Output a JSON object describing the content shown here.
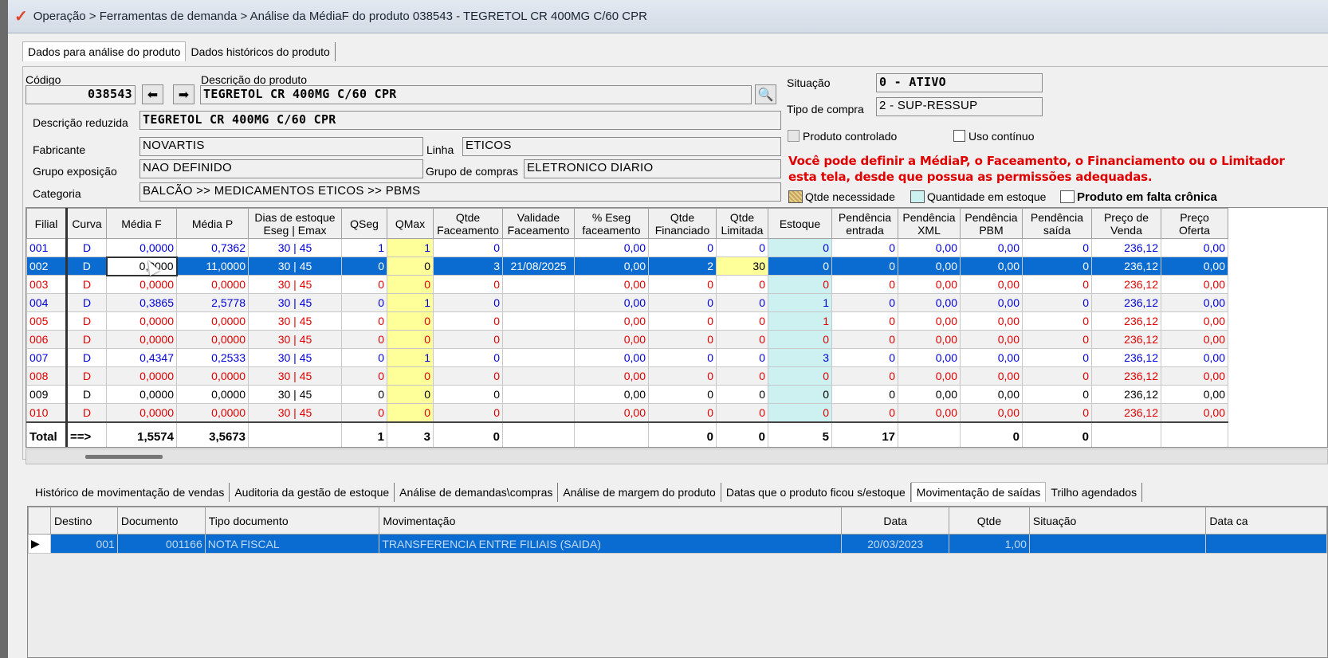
{
  "window": {
    "title": "Operação > Ferramentas de demanda > Análise da MédiaF do produto 038543 - TEGRETOL CR 400MG C/60 CPR"
  },
  "top_tabs": [
    "Dados para análise do produto",
    "Dados históricos do produto"
  ],
  "product": {
    "codigo_label": "Código",
    "codigo": "038543",
    "descricao_label": "Descrição do produto",
    "descricao": "TEGRETOL CR 400MG C/60 CPR",
    "descricao_reduzida_label": "Descrição reduzida",
    "descricao_reduzida": "TEGRETOL CR 400MG C/60 CPR",
    "fabricante_label": "Fabricante",
    "fabricante": "NOVARTIS",
    "linha_label": "Linha",
    "linha": "ETICOS",
    "grupo_exposicao_label": "Grupo exposição",
    "grupo_exposicao": "NAO DEFINIDO",
    "grupo_compras_label": "Grupo de compras",
    "grupo_compras": "ELETRONICO DIARIO",
    "categoria_label": "Categoria",
    "categoria": "BALCÃO >> MEDICAMENTOS ETICOS >> PBMS",
    "situacao_label": "Situação",
    "situacao": "0 - ATIVO",
    "tipo_compra_label": "Tipo de compra",
    "tipo_compra": "2 - SUP-RESSUP",
    "controlado_label": "Produto controlado",
    "uso_continuo_label": "Uso contínuo",
    "warning_line1": "Você pode definir a MédiaP, o Faceamento, o Financiamento ou o Limitador",
    "warning_line2": "esta tela, desde que possua as permissões adequadas."
  },
  "legend": {
    "necessidade": "Qtde necessidade",
    "estoque": "Quantidade em estoque",
    "falta": "Produto em falta crônica",
    "colors": {
      "necessidade": "#d8b86a",
      "estoque": "#cdf0f0",
      "falta": "#ffffff"
    }
  },
  "grid": {
    "headers": [
      "Filial",
      "Curva",
      "Média F",
      "Média P",
      "Dias de estoque\nEseg | Emax",
      "QSeg",
      "QMax",
      "Qtde\nFaceamento",
      "Validade\nFaceamento",
      "% Eseg\nfaceamento",
      "Qtde\nFinanciado",
      "Qtde\nLimitada",
      "Estoque",
      "Pendência\nentrada",
      "Pendência\nXML",
      "Pendência\nPBM",
      "Pendência\nsaída",
      "Preço de\nVenda",
      "Preço\nOferta"
    ],
    "rows": [
      {
        "color": "blue",
        "cells": [
          "001",
          "D",
          "0,0000",
          "0,7362",
          "30   |   45",
          "1",
          "1",
          "0",
          "",
          "0,00",
          "0",
          "0",
          "0",
          "0",
          "0,00",
          "0,00",
          "0",
          "236,12",
          "0,00"
        ]
      },
      {
        "color": "sel",
        "cells": [
          "002",
          "D",
          "0,0000",
          "11,0000",
          "30   |   45",
          "0",
          "0",
          "3",
          "21/08/2025",
          "0,00",
          "2",
          "30",
          "0",
          "0",
          "0,00",
          "0,00",
          "0",
          "236,12",
          "0,00"
        ]
      },
      {
        "color": "red",
        "cells": [
          "003",
          "D",
          "0,0000",
          "0,0000",
          "30   |   45",
          "0",
          "0",
          "0",
          "",
          "0,00",
          "0",
          "0",
          "0",
          "0",
          "0,00",
          "0,00",
          "0",
          "236,12",
          "0,00"
        ]
      },
      {
        "color": "blue",
        "cells": [
          "004",
          "D",
          "0,3865",
          "2,5778",
          "30   |   45",
          "0",
          "1",
          "0",
          "",
          "0,00",
          "0",
          "0",
          "1",
          "0",
          "0,00",
          "0,00",
          "0",
          "236,12",
          "0,00"
        ]
      },
      {
        "color": "red",
        "cells": [
          "005",
          "D",
          "0,0000",
          "0,0000",
          "30   |   45",
          "0",
          "0",
          "0",
          "",
          "0,00",
          "0",
          "0",
          "1",
          "0",
          "0,00",
          "0,00",
          "0",
          "236,12",
          "0,00"
        ]
      },
      {
        "color": "red",
        "cells": [
          "006",
          "D",
          "0,0000",
          "0,0000",
          "30   |   45",
          "0",
          "0",
          "0",
          "",
          "0,00",
          "0",
          "0",
          "0",
          "0",
          "0,00",
          "0,00",
          "0",
          "236,12",
          "0,00"
        ]
      },
      {
        "color": "blue",
        "cells": [
          "007",
          "D",
          "0,4347",
          "0,2533",
          "30   |   45",
          "0",
          "1",
          "0",
          "",
          "0,00",
          "0",
          "0",
          "3",
          "0",
          "0,00",
          "0,00",
          "0",
          "236,12",
          "0,00"
        ]
      },
      {
        "color": "red",
        "cells": [
          "008",
          "D",
          "0,0000",
          "0,0000",
          "30   |   45",
          "0",
          "0",
          "0",
          "",
          "0,00",
          "0",
          "0",
          "0",
          "0",
          "0,00",
          "0,00",
          "0",
          "236,12",
          "0,00"
        ]
      },
      {
        "color": "black",
        "cells": [
          "009",
          "D",
          "0,0000",
          "0,0000",
          "30   |   45",
          "0",
          "0",
          "0",
          "",
          "0,00",
          "0",
          "0",
          "0",
          "0",
          "0,00",
          "0,00",
          "0",
          "236,12",
          "0,00"
        ]
      },
      {
        "color": "red",
        "cells": [
          "010",
          "D",
          "0,0000",
          "0,0000",
          "30   |   45",
          "0",
          "0",
          "0",
          "",
          "0,00",
          "0",
          "0",
          "0",
          "0",
          "0,00",
          "0,00",
          "0",
          "236,12",
          "0,00"
        ]
      }
    ],
    "total": [
      "Total",
      "==>",
      "1,5574",
      "3,5673",
      "",
      "1",
      "3",
      "0",
      "",
      "",
      "0",
      "0",
      "5",
      "17",
      "",
      "0",
      "0",
      "",
      ""
    ]
  },
  "bottom_tabs": [
    "Histórico de movimentação de vendas",
    "Auditoria da gestão de estoque",
    "Análise de demandas\\compras",
    "Análise de margem do produto",
    "Datas que o produto ficou s/estoque",
    "Movimentação de saídas",
    "Trilho agendados"
  ],
  "bottom_grid": {
    "headers": [
      "Destino",
      "Documento",
      "Tipo documento",
      "Movimentação",
      "Data",
      "Qtde",
      "Situação",
      "Data ca"
    ],
    "rows": [
      [
        "001",
        "001166",
        "NOTA FISCAL",
        "TRANSFERENCIA ENTRE FILIAIS (SAIDA)",
        "20/03/2023",
        "1,00",
        "",
        ""
      ]
    ]
  }
}
